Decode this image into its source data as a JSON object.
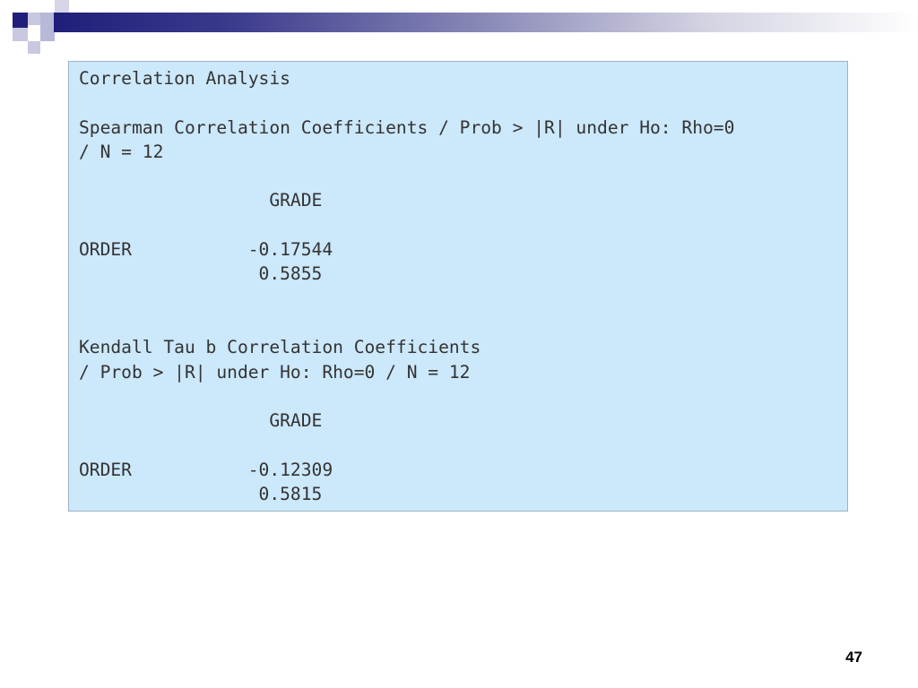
{
  "theme": {
    "header_dark": "#1f1f7a",
    "header_light": "#b8b8d8",
    "box_background": "#cce8fb",
    "box_border": "#9fb0c4",
    "text_color": "#333333"
  },
  "output": {
    "lines": [
      "Correlation Analysis",
      "",
      "Spearman Correlation Coefficients / Prob > |R| under Ho: Rho=0",
      "/ N = 12",
      "",
      "                  GRADE",
      "",
      "ORDER           -0.17544",
      "                 0.5855",
      "",
      "",
      "Kendall Tau b Correlation Coefficients",
      "/ Prob > |R| under Ho: Rho=0 / N = 12",
      "",
      "                  GRADE",
      "",
      "ORDER           -0.12309",
      "                 0.5815"
    ]
  },
  "footer": {
    "page_number": "47"
  }
}
